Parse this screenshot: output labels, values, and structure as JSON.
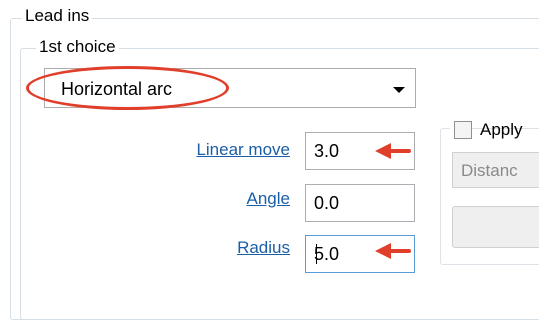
{
  "groups": {
    "outer_title": "Lead ins",
    "inner_title": "1st choice"
  },
  "dropdown": {
    "selected": "Horizontal arc",
    "icon": "chevron-down-icon"
  },
  "fields": [
    {
      "label": "Linear move",
      "value": "3.0"
    },
    {
      "label": "Angle",
      "value": "0.0"
    },
    {
      "label": "Radius",
      "value": "5.0"
    }
  ],
  "right_panel": {
    "apply_label": "Apply",
    "dropdown_text": "Distanc"
  },
  "colors": {
    "annotation_red": "#e0402b",
    "link_blue": "#1a5ea8",
    "group_border": "#d5dfe5"
  }
}
